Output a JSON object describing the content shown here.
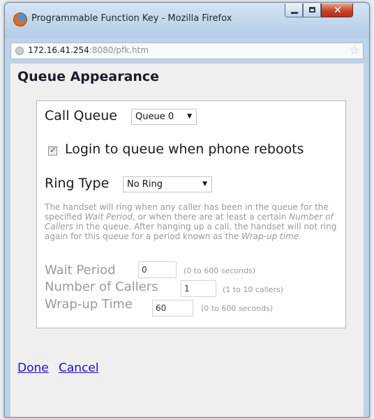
{
  "window": {
    "title": "Programmable Function Key - Mozilla Firefox",
    "close_glyph": "✕"
  },
  "urlbar": {
    "host": "172.16.41.254",
    "rest": ":8080/pfk.htm",
    "star_glyph": "☆"
  },
  "page": {
    "heading": "Queue Appearance"
  },
  "form": {
    "call_queue_label": "Call Queue",
    "call_queue_value": "Queue 0",
    "login_checkbox_label": "Login to queue when phone reboots",
    "login_checked": true,
    "ring_type_label": "Ring Type",
    "ring_type_value": "No Ring",
    "caret_glyph": "▼",
    "description": {
      "part1": "The handset will ring when any caller has been in the queue for the specified ",
      "em1": "Wait Period",
      "part2": ", or when there are at least a certain ",
      "em2": "Number of Callers",
      "part3": " in the queue. After hanging up a call, the handset will not ring again for this queue for a period known as the ",
      "em3": "Wrap-up time",
      "part4": "."
    },
    "wait_period": {
      "label": "Wait Period",
      "value": "0",
      "hint": "(0 to 600 seconds)"
    },
    "num_callers": {
      "label": "Number of Callers",
      "value": "1",
      "hint": "(1 to 10 callers)"
    },
    "wrapup": {
      "label": "Wrap-up Time",
      "value": "60",
      "hint": "(0 to 600 seconds)"
    }
  },
  "actions": {
    "done_label": "Done",
    "cancel_label": "Cancel"
  }
}
